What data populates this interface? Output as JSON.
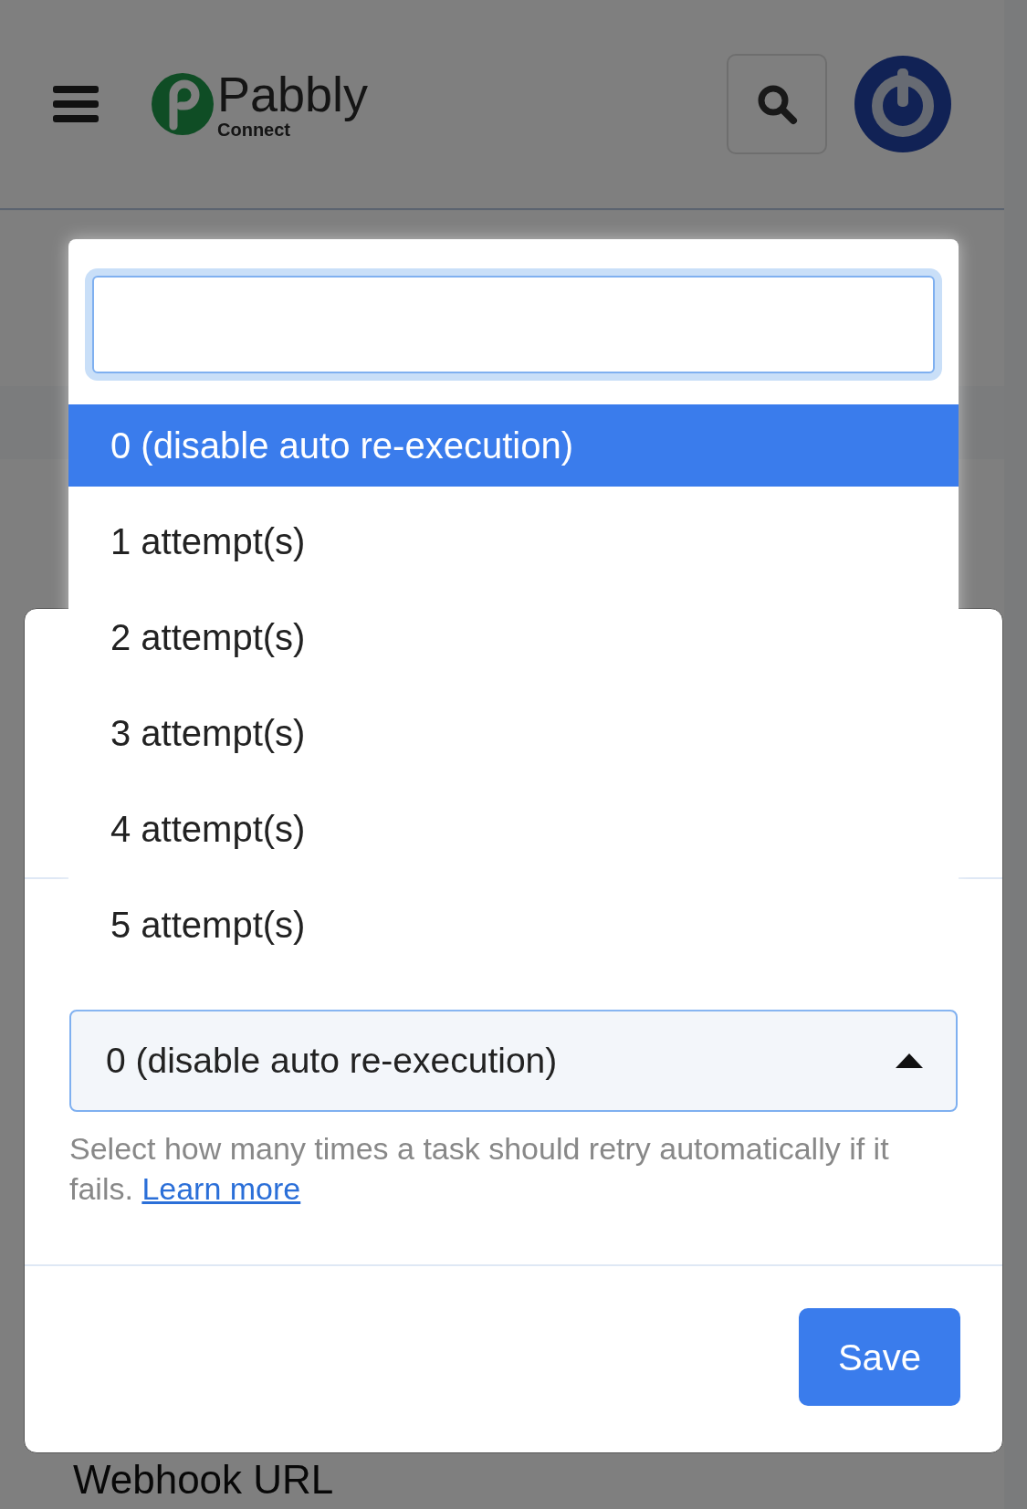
{
  "header": {
    "brand": "Pabbly",
    "brand_sub": "Connect"
  },
  "background": {
    "section_label": "Webhook URL"
  },
  "modal": {
    "select": {
      "value": "0 (disable auto re-execution)",
      "expanded": true
    },
    "help_text": "Select how many times a task should retry automatically if it fails.",
    "help_link": "Learn more",
    "save_button": "Save"
  },
  "dropdown": {
    "options": [
      {
        "label": "0 (disable auto re-execution)",
        "selected": true
      },
      {
        "label": "1 attempt(s)",
        "selected": false
      },
      {
        "label": "2 attempt(s)",
        "selected": false
      },
      {
        "label": "3 attempt(s)",
        "selected": false
      },
      {
        "label": "4 attempt(s)",
        "selected": false
      },
      {
        "label": "5 attempt(s)",
        "selected": false
      }
    ]
  }
}
